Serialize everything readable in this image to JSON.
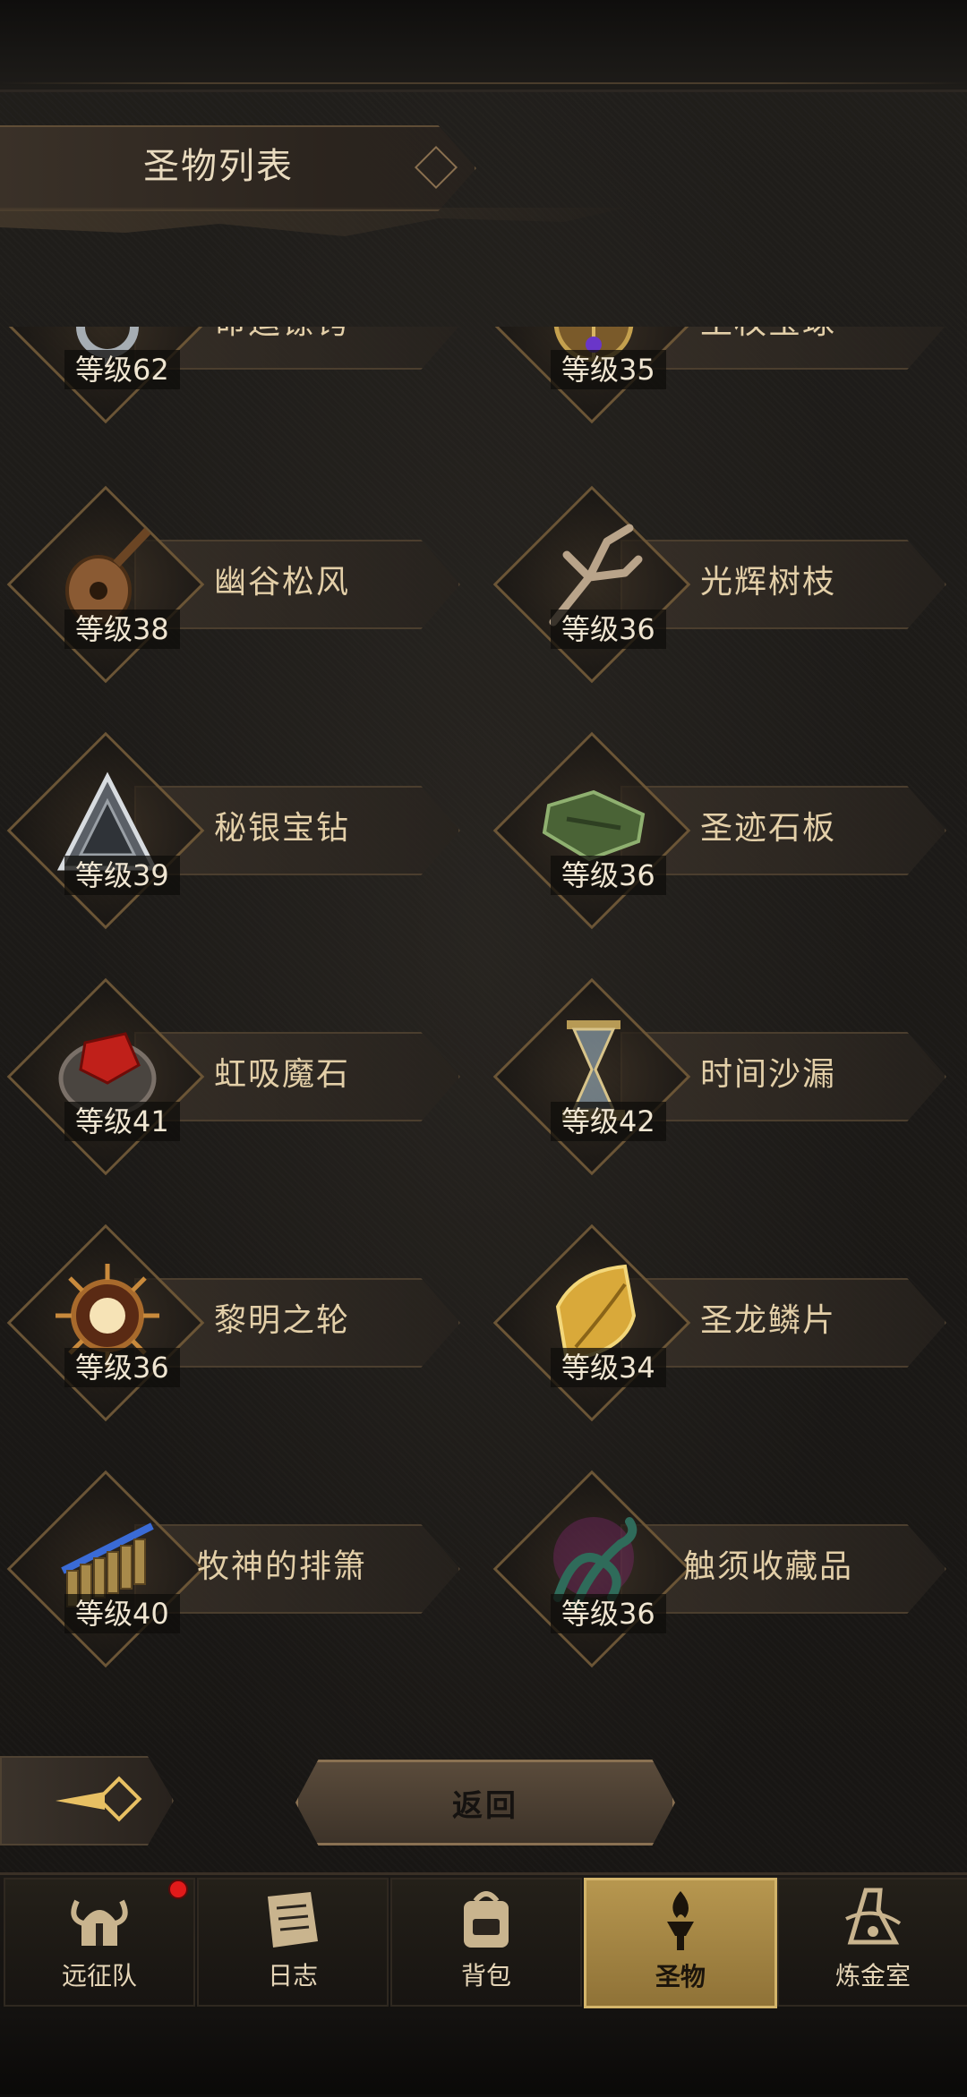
{
  "header": {
    "title": "圣物列表"
  },
  "relics": [
    {
      "name": "命运镣铐",
      "level_prefix": "等级",
      "level": "62",
      "icon": "shackle-icon",
      "accent": "#9aa1a8"
    },
    {
      "name": "王权宝球",
      "level_prefix": "等级",
      "level": "35",
      "icon": "orb-icon",
      "accent": "#b08a3e"
    },
    {
      "name": "幽谷松风",
      "level_prefix": "等级",
      "level": "38",
      "icon": "lute-icon",
      "accent": "#8a5a33"
    },
    {
      "name": "光辉树枝",
      "level_prefix": "等级",
      "level": "36",
      "icon": "branch-icon",
      "accent": "#b9a48a"
    },
    {
      "name": "秘银宝钻",
      "level_prefix": "等级",
      "level": "39",
      "icon": "pyramid-icon",
      "accent": "#c9ccd1"
    },
    {
      "name": "圣迹石板",
      "level_prefix": "等级",
      "level": "36",
      "icon": "stone-tablet-icon",
      "accent": "#5d7a45"
    },
    {
      "name": "虹吸魔石",
      "level_prefix": "等级",
      "level": "41",
      "icon": "red-stone-icon",
      "accent": "#c0201a"
    },
    {
      "name": "时间沙漏",
      "level_prefix": "等级",
      "level": "42",
      "icon": "hourglass-icon",
      "accent": "#b79a55"
    },
    {
      "name": "黎明之轮",
      "level_prefix": "等级",
      "level": "36",
      "icon": "dawn-wheel-icon",
      "accent": "#e8a24a"
    },
    {
      "name": "圣龙鳞片",
      "level_prefix": "等级",
      "level": "34",
      "icon": "dragon-scale-icon",
      "accent": "#e3b842"
    },
    {
      "name": "牧神的排箫",
      "level_prefix": "等级",
      "level": "40",
      "icon": "panpipe-icon",
      "accent": "#3a6bd6"
    },
    {
      "name": "触须收藏品",
      "level_prefix": "等级",
      "level": "36",
      "icon": "tentacle-icon",
      "accent": "#2f6b5a"
    }
  ],
  "footer": {
    "return_label": "返回"
  },
  "nav": {
    "items": [
      {
        "label": "远征队",
        "icon": "viking-helmet-icon",
        "active": false,
        "badge": true
      },
      {
        "label": "日志",
        "icon": "scroll-icon",
        "active": false,
        "badge": false
      },
      {
        "label": "背包",
        "icon": "backpack-icon",
        "active": false,
        "badge": false
      },
      {
        "label": "圣物",
        "icon": "torch-icon",
        "active": true,
        "badge": false
      },
      {
        "label": "炼金室",
        "icon": "alchemy-icon",
        "active": false,
        "badge": false
      }
    ]
  },
  "colors": {
    "accent_gold": "#c8a55a",
    "text_light": "#e3cfa8",
    "badge_red": "#e11a1a"
  }
}
